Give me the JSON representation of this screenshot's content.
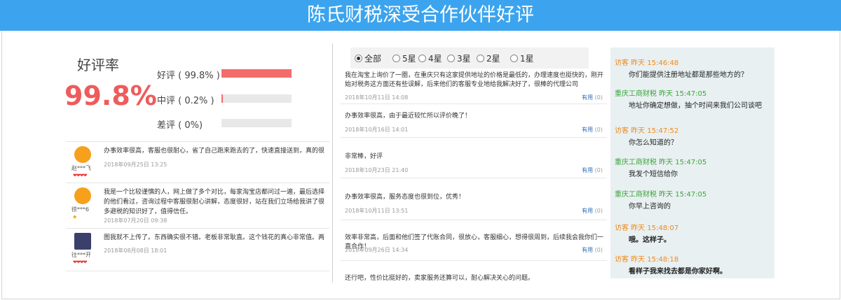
{
  "banner": {
    "title": "陈氏财税深受合作伙伴好评"
  },
  "rating": {
    "title": "好评率",
    "big_value": "99.8%",
    "bars": [
      {
        "label": "好评 ( 99.8% )",
        "fraction": 0.998
      },
      {
        "label": "中评 ( 0.2% )",
        "fraction": 0.002
      },
      {
        "label": "差评 ( 0%)",
        "fraction": 0.0
      }
    ]
  },
  "left_reviews": [
    {
      "nick": "赵***飞",
      "level": "❤❤❤❤",
      "text": "办事效率很高，客服也很耐心，省了自己跑来跑去的了，快速直接送到，真的很方便",
      "date": "2018年09月25日 13:25"
    },
    {
      "nick": "徐***6",
      "level": "◆",
      "text": "我是一个比较谨慎的人，网上做了多个对比，每家淘宝店都问过一遍，最后选择的他们看过，咨询过程中客服很耐心讲解，态度很好，站在我们立场给我讲了很多避税的知识好了，值得信任。",
      "date": "2018年07月20日 09:38"
    },
    {
      "nick": "往***开",
      "level": "❤❤❤❤",
      "text": "图我就不上传了。东西确实很不错。老板非常耿直。这个钱花的真心非常值。两天就注",
      "date": "2018年08月08日 18:01"
    }
  ],
  "filters": {
    "options": [
      "全部",
      "5星",
      "4星",
      "3星",
      "2星",
      "1星"
    ],
    "selected": "全部"
  },
  "middle_reviews": [
    {
      "text": "我在淘宝上询价了一圈，在重庆只有这家提供地址的价格是最低的，办理速度也挺快的，刚开始对税务这方面还有些误解，后来他们的客服专业地给我解决好了，很棒的代理公司",
      "date": "2018年10月11日 14:08",
      "useful": "有用",
      "count": "(0)"
    },
    {
      "text": "办事效率很高，由于最近较忙所以评价晚了！",
      "date": "2018年10月16日 14:01",
      "useful": "有用",
      "count": "(0)"
    },
    {
      "text": "非常棒，好评",
      "date": "2018年10月23日 21:40",
      "useful": "有用",
      "count": "(0)"
    },
    {
      "text": "办事效率很高，服务态度也很到位，优秀！",
      "date": "2018年10月11日 13:51",
      "useful": "有用",
      "count": "(0)"
    },
    {
      "text": "效率非常高，后面和他们签了代账合同，很放心，客服细心，想得很周到，后续我会我你们一直合作！",
      "date": "2018年09月26日 14:34",
      "useful": "有用",
      "count": "(0)"
    },
    {
      "text": "还行吧，性价比挺好的，卖家服务还算可以，耐心解决关心的问题。",
      "date": "",
      "useful": "",
      "count": ""
    }
  ],
  "chat": [
    {
      "role": "visitor",
      "header": "访客  昨天 15:46:48",
      "body": "你们能提供注册地址都是那些地方的？"
    },
    {
      "role": "agent",
      "header": "重庆工商财税 昨天 15:47:05",
      "body": "地址你确定想做，抽个时间来我们公司谈吧"
    },
    {
      "role": "visitor",
      "header": "访客  昨天 15:47:52",
      "body": "你怎么知道的？"
    },
    {
      "role": "agent",
      "header": "重庆工商财税 昨天 15:47:05",
      "body": "我发个短信给你"
    },
    {
      "role": "agent",
      "header": "重庆工商财税 昨天 15:47:05",
      "body": "你早上咨询的"
    },
    {
      "role": "visitor",
      "header": "访客  昨天 15:48:07",
      "body": "哦。这样子。"
    },
    {
      "role": "visitor",
      "header": "访客  昨天 15:48:18",
      "body": "看样子我来找去都是你家好啊。"
    }
  ],
  "colors": {
    "banner": "#3ca4ee",
    "accent_red": "#ef5b5b",
    "visitor": "#f08a18",
    "agent": "#3ca63c"
  }
}
